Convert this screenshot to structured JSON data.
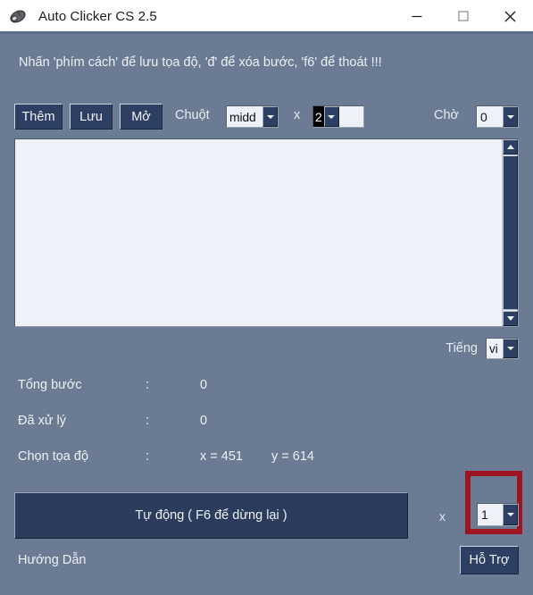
{
  "window": {
    "title": "Auto Clicker CS 2.5",
    "icon": "mouse-icon",
    "minimize_label": "—",
    "maximize_label": "□",
    "close_label": "✕"
  },
  "hint": {
    "text": "Nhấn 'phím cách' để lưu tọa độ, 'đ' để xóa bước, 'f6' để thoát !!!"
  },
  "toolbar": {
    "add_label": "Thêm",
    "save_label": "Lưu",
    "open_label": "Mở",
    "mouse_label": "Chuột",
    "mouse_value": "midd",
    "times_symbol": "x",
    "click_count_value": "2",
    "wait_label": "Chờ",
    "wait_value": "0"
  },
  "steps_area": {
    "content": "",
    "scroll_up_icon": "scroll-up-arrow-icon",
    "scroll_down_icon": "scroll-down-arrow-icon"
  },
  "language": {
    "label": "Tiếng",
    "value": "vi"
  },
  "stats": [
    {
      "key": "Tổng bước",
      "colon": ":",
      "value": "0",
      "value2": ""
    },
    {
      "key": "Đã xử lý",
      "colon": ":",
      "value": "0",
      "value2": ""
    },
    {
      "key": "Chọn tọa độ",
      "colon": ":",
      "value": "x = 451",
      "value2": "y = 614"
    }
  ],
  "auto_run": {
    "button_label": "Tự động ( F6 để dừng lại )",
    "times_symbol": "x",
    "repeat_value": "1",
    "highlight_color": "#9e1421"
  },
  "footer": {
    "guide_label": "Hướng Dẫn",
    "support_label": "Hỗ Trợ"
  },
  "colors": {
    "window_background": "#6a7b93",
    "button_navy": "#2d3f63",
    "auto_button_navy": "#2b3c5c",
    "field_background": "#eef1f7",
    "text_light": "#eef1f6",
    "titlebar_background": "#ffffff",
    "annotation_red": "#9e1421"
  }
}
